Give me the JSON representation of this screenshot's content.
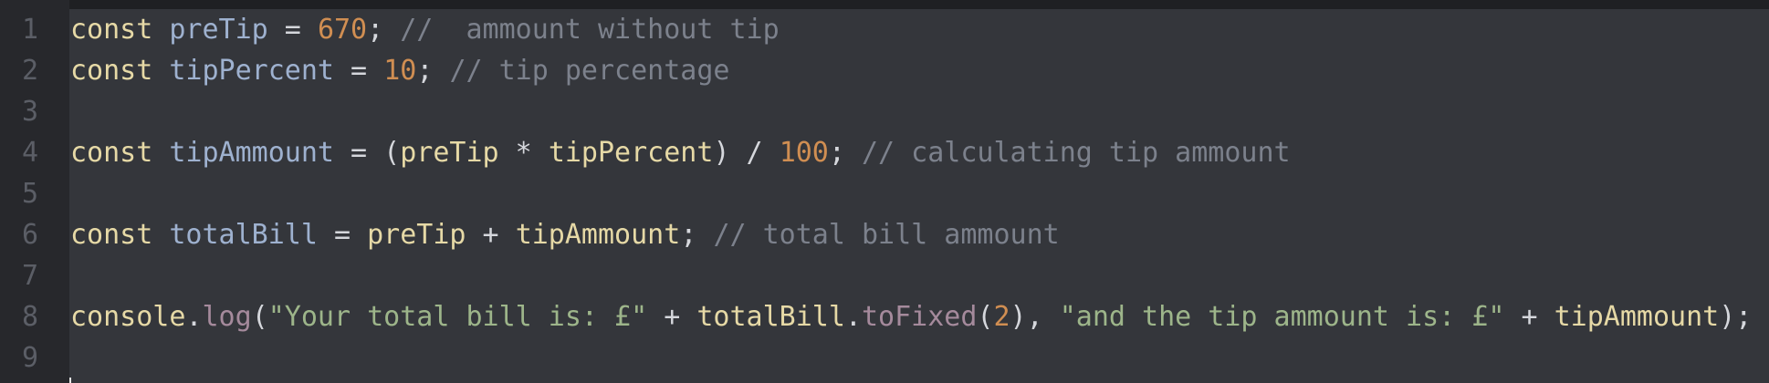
{
  "editor": {
    "lines": [
      {
        "number": "1",
        "tokens": [
          {
            "text": "const",
            "type": "kw"
          },
          {
            "text": " ",
            "type": "op"
          },
          {
            "text": "preTip",
            "type": "var"
          },
          {
            "text": " = ",
            "type": "op"
          },
          {
            "text": "670",
            "type": "num"
          },
          {
            "text": "; ",
            "type": "op"
          },
          {
            "text": "//  ammount without tip",
            "type": "cmt"
          }
        ]
      },
      {
        "number": "2",
        "tokens": [
          {
            "text": "const",
            "type": "kw"
          },
          {
            "text": " ",
            "type": "op"
          },
          {
            "text": "tipPercent",
            "type": "var"
          },
          {
            "text": " = ",
            "type": "op"
          },
          {
            "text": "10",
            "type": "num"
          },
          {
            "text": "; ",
            "type": "op"
          },
          {
            "text": "// tip percentage",
            "type": "cmt"
          }
        ]
      },
      {
        "number": "3",
        "tokens": []
      },
      {
        "number": "4",
        "tokens": [
          {
            "text": "const",
            "type": "kw"
          },
          {
            "text": " ",
            "type": "op"
          },
          {
            "text": "tipAmmount",
            "type": "var"
          },
          {
            "text": " = (",
            "type": "op"
          },
          {
            "text": "preTip",
            "type": "fn"
          },
          {
            "text": " * ",
            "type": "op"
          },
          {
            "text": "tipPercent",
            "type": "fn"
          },
          {
            "text": ") / ",
            "type": "op"
          },
          {
            "text": "100",
            "type": "num"
          },
          {
            "text": "; ",
            "type": "op"
          },
          {
            "text": "// calculating tip ammount",
            "type": "cmt"
          }
        ]
      },
      {
        "number": "5",
        "tokens": []
      },
      {
        "number": "6",
        "tokens": [
          {
            "text": "const",
            "type": "kw"
          },
          {
            "text": " ",
            "type": "op"
          },
          {
            "text": "totalBill",
            "type": "var"
          },
          {
            "text": " = ",
            "type": "op"
          },
          {
            "text": "preTip",
            "type": "fn"
          },
          {
            "text": " + ",
            "type": "op"
          },
          {
            "text": "tipAmmount",
            "type": "fn"
          },
          {
            "text": "; ",
            "type": "op"
          },
          {
            "text": "// total bill ammount",
            "type": "cmt"
          }
        ]
      },
      {
        "number": "7",
        "tokens": []
      },
      {
        "number": "8",
        "tokens": [
          {
            "text": "console",
            "type": "fn"
          },
          {
            "text": ".",
            "type": "op"
          },
          {
            "text": "log",
            "type": "mth"
          },
          {
            "text": "(",
            "type": "op"
          },
          {
            "text": "\"Your total bill is: £\"",
            "type": "str"
          },
          {
            "text": " + ",
            "type": "op"
          },
          {
            "text": "totalBill",
            "type": "fn"
          },
          {
            "text": ".",
            "type": "op"
          },
          {
            "text": "toFixed",
            "type": "mth"
          },
          {
            "text": "(",
            "type": "op"
          },
          {
            "text": "2",
            "type": "num"
          },
          {
            "text": "), ",
            "type": "op"
          },
          {
            "text": "\"and the tip ammount is: £\"",
            "type": "str"
          },
          {
            "text": " + ",
            "type": "op"
          },
          {
            "text": "tipAmmount",
            "type": "fn"
          },
          {
            "text": ");",
            "type": "op"
          }
        ]
      },
      {
        "number": "9",
        "tokens": []
      }
    ]
  },
  "colors": {
    "background": "#2b2c30",
    "code_background": "#34363b",
    "keyword": "#e6d9a6",
    "variable": "#9eb1cf",
    "number": "#d08e52",
    "comment": "#7c818c",
    "string": "#9db58a",
    "method": "#a58a9c"
  }
}
